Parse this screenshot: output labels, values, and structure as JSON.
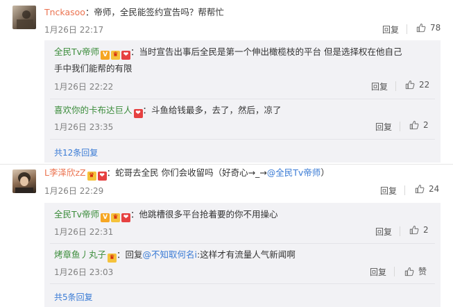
{
  "c1": {
    "user": "Tnckasoo",
    "text": "：帝师，全民能签约宣告吗？帮帮忙",
    "time": "1月26日 22:17",
    "reply": "回复",
    "likes": "78"
  },
  "c1_replies": [
    {
      "user": "全民Tv帝师",
      "text1": "：当时宣告出事后全民是第一个伸出橄榄枝的平台 但是选择权在他自己",
      "text2": "手中我们能帮的有限",
      "time": "1月26日 22:22",
      "reply": "回复",
      "likes": "22"
    },
    {
      "user": "喜欢你的卡布达巨人",
      "text1": "：斗鱼给钱最多，去了，然后，凉了",
      "time": "1月26日 23:35",
      "reply": "回复",
      "likes": "2"
    }
  ],
  "c1_more": "共12条回复",
  "c2": {
    "user": "L李泽欣zZ",
    "text": "：蛇哥去全民 你们会收留吗（好奇心→_→",
    "mention": "@全民Tv帝师",
    "text_end": "）",
    "time": "1月26日 22:29",
    "reply": "回复",
    "likes": "24"
  },
  "c2_replies": [
    {
      "user": "全民Tv帝师",
      "text1": "：他跳槽很多平台抢着要的你不用操心",
      "time": "1月26日 22:31",
      "reply": "回复",
      "likes": "2"
    },
    {
      "user": "烤章鱼丿丸子",
      "text_a": "：回复",
      "mention": "@不知取何名i",
      "text_b": ":这样才有流量人气新闻啊",
      "time": "1月26日 23:03",
      "reply": "回复",
      "likes": "赞"
    }
  ],
  "c2_more": "共5条回复",
  "badges": {
    "v": "V",
    "heart": "❤"
  },
  "colors": {
    "name": "#eb7350",
    "reply_name": "#3b8c3b",
    "link": "#3a7bd5",
    "sub_bg": "#f2f2f5"
  }
}
